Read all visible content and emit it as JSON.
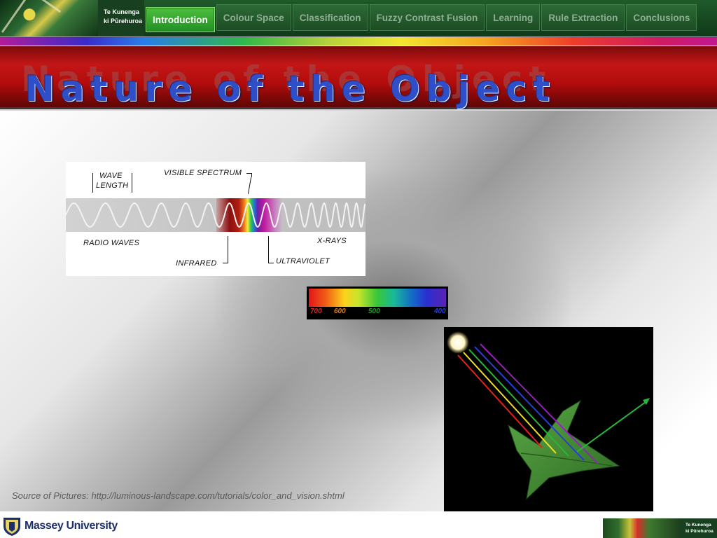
{
  "header": {
    "brand_line1": "Te Kunenga",
    "brand_line2": "ki Pūrehuroa",
    "tabs": [
      {
        "label": "Introduction",
        "active": true
      },
      {
        "label": "Colour Space",
        "active": false
      },
      {
        "label": "Classification",
        "active": false
      },
      {
        "label": "Fuzzy Contrast Fusion",
        "active": false
      },
      {
        "label": "Learning",
        "active": false
      },
      {
        "label": "Rule Extraction",
        "active": false
      },
      {
        "label": "Conclusions",
        "active": false
      }
    ]
  },
  "slide": {
    "title": "Nature of the Object"
  },
  "spectrum_figure": {
    "wave_length_line1": "WAVE",
    "wave_length_line2": "LENGTH",
    "visible_spectrum": "VISIBLE SPECTRUM",
    "radio_waves": "RADIO WAVES",
    "infrared": "INFRARED",
    "ultraviolet": "ULTRAVIOLET",
    "x_rays": "X-RAYS"
  },
  "color_scale": {
    "labels": [
      {
        "text": "700",
        "color": "#d42a1f"
      },
      {
        "text": "600",
        "color": "#e07a16"
      },
      {
        "text": "500",
        "color": "#1f9a2c"
      },
      {
        "text": "400",
        "color": "#2a3fd0"
      }
    ]
  },
  "source_note": "Source of Pictures: http://luminous-landscape.com/tutorials/color_and_vision.shtml",
  "footer": {
    "university": "Massey University",
    "brand_line1": "Te Kunenga",
    "brand_line2": "ki Pūrehuroa"
  },
  "colors": {
    "nav_active": "#2f9f2a",
    "title_blue": "#2f4fc8",
    "banner_red": "#c41616"
  }
}
